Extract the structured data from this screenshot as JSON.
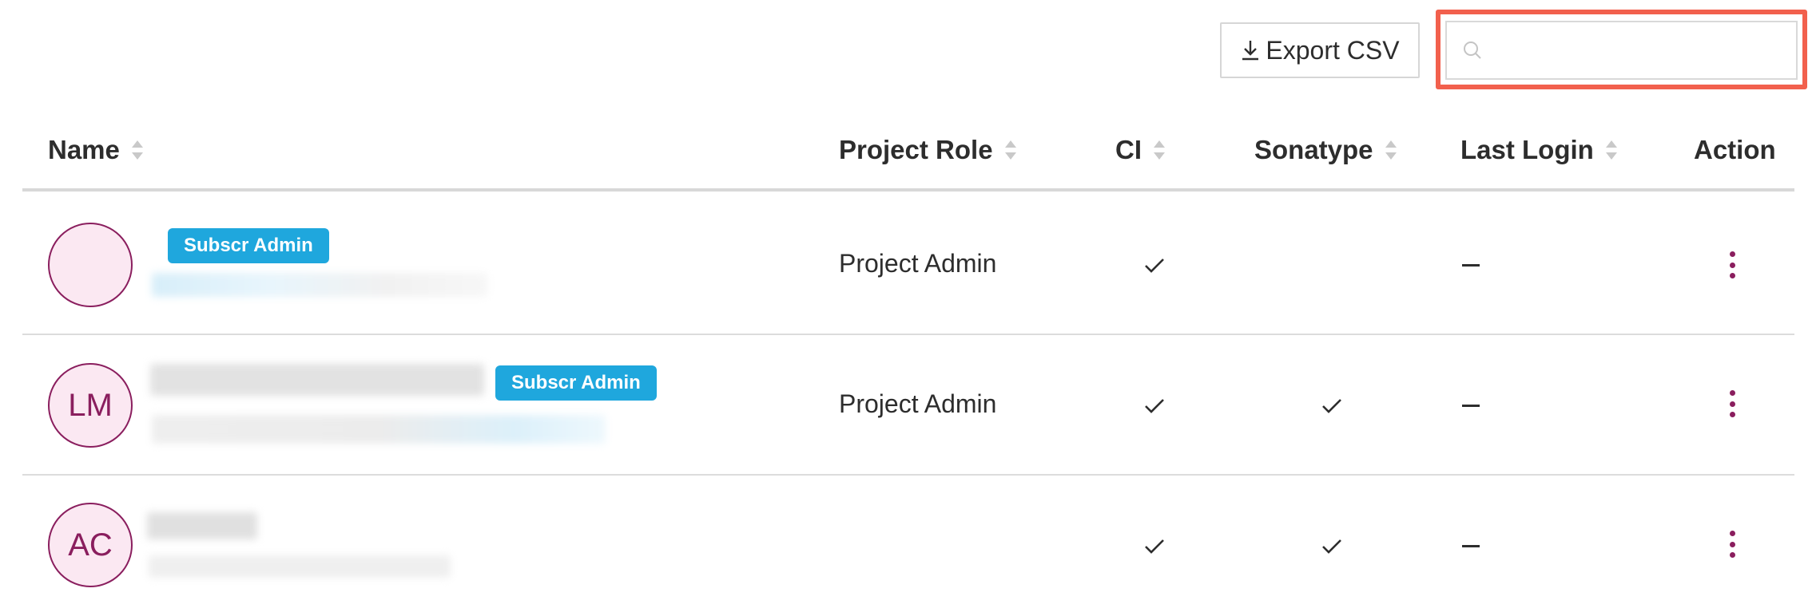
{
  "toolbar": {
    "export_label": "Export CSV",
    "export_icon": "download-icon",
    "search": {
      "value": "",
      "placeholder": "",
      "icon": "search-icon"
    }
  },
  "table": {
    "columns": [
      {
        "label": "Name",
        "sortable": true
      },
      {
        "label": "Project Role",
        "sortable": true
      },
      {
        "label": "CI",
        "sortable": true
      },
      {
        "label": "Sonatype",
        "sortable": true
      },
      {
        "label": "Last Login",
        "sortable": true
      },
      {
        "label": "Action",
        "sortable": false
      }
    ],
    "rows": [
      {
        "initials": "",
        "badge": "Subscr Admin",
        "role": "Project Admin",
        "ci": true,
        "sonatype": false,
        "last_login": "–"
      },
      {
        "initials": "LM",
        "badge": "Subscr Admin",
        "role": "Project Admin",
        "ci": true,
        "sonatype": true,
        "last_login": "–"
      },
      {
        "initials": "AC",
        "badge": "",
        "role": "",
        "ci": true,
        "sonatype": true,
        "last_login": "–"
      }
    ]
  },
  "colors": {
    "accent": "#8a1e5e",
    "avatar_bg": "#fbe8f2",
    "badge": "#1fa7dd",
    "highlight": "#f2604d"
  }
}
